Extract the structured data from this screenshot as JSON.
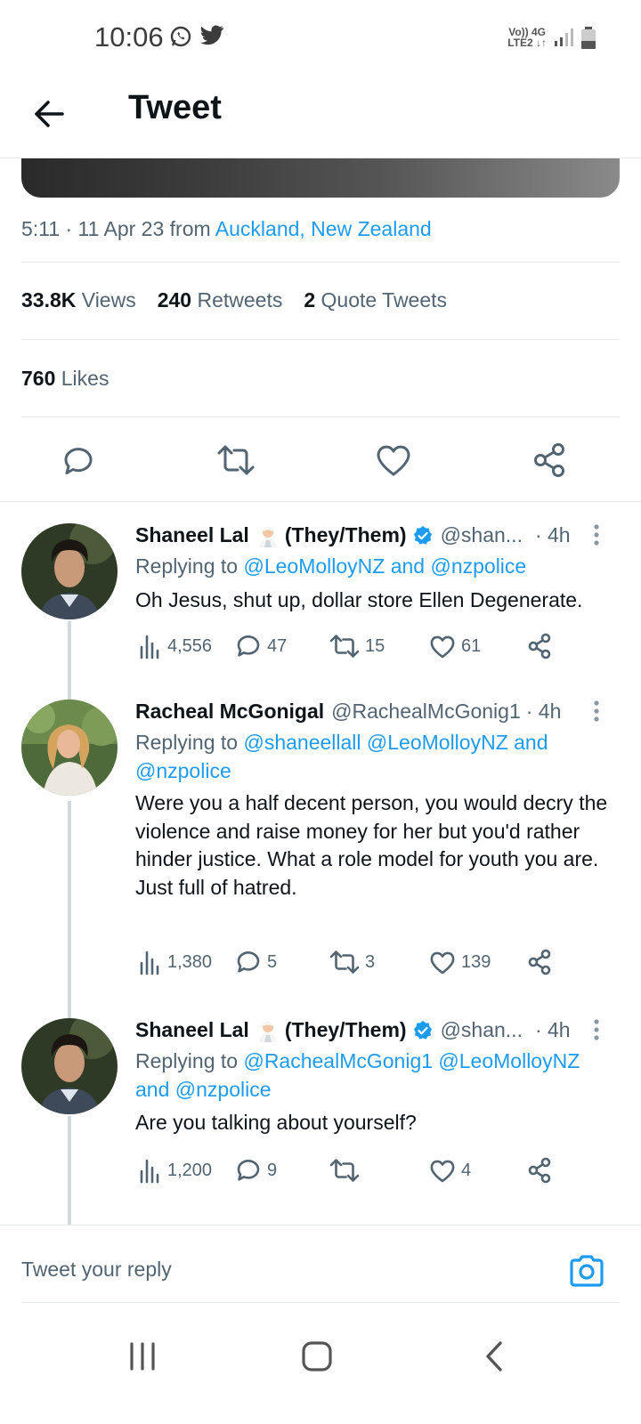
{
  "status_bar": {
    "time": "10:06",
    "network_top": "Vo)) 4G",
    "network_bottom": "LTE2 ↓↑",
    "app_icons": [
      "whatsapp-icon",
      "twitter-icon"
    ]
  },
  "header": {
    "title": "Tweet"
  },
  "tweet_meta": {
    "datetime": "5:11 · 11 Apr 23 from ",
    "location": "Auckland, New Zealand"
  },
  "stats": {
    "views_count": "33.8K",
    "views_label": "Views",
    "retweets_count": "240",
    "retweets_label": "Retweets",
    "quotes_count": "2",
    "quotes_label": "Quote Tweets",
    "likes_count": "760",
    "likes_label": "Likes"
  },
  "replies": [
    {
      "name": "Shaneel Lal",
      "name_suffix": "(They/Them)",
      "verified": true,
      "handle": "@shan...",
      "time": "· 4h",
      "replying_prefix": "Replying to ",
      "replying_line1": "@LeoMolloyNZ and @nzpolice",
      "replying_line2": "",
      "text": "Oh Jesus, shut up, dollar store Ellen Degenerate.",
      "views": "4,556",
      "comments": "47",
      "retweets": "15",
      "likes": "61"
    },
    {
      "name": "Racheal McGonigal",
      "name_suffix": "",
      "verified": false,
      "handle": "@RachealMcGonig1",
      "time": "· 4h",
      "replying_prefix": "Replying to ",
      "replying_line1": "@shaneellall @LeoMolloyNZ and",
      "replying_line2": "@nzpolice",
      "text": "Were you a half decent person, you would decry the violence and raise money for her but you'd rather hinder justice. What a role model for youth you are.\nJust full of hatred.",
      "views": "1,380",
      "comments": "5",
      "retweets": "3",
      "likes": "139"
    },
    {
      "name": "Shaneel Lal",
      "name_suffix": "(They/Them)",
      "verified": true,
      "handle": "@shan...",
      "time": "· 4h",
      "replying_prefix": "Replying to ",
      "replying_line1": "@RachealMcGonig1 @LeoMolloyNZ",
      "replying_line2": "and @nzpolice",
      "text": "Are you talking about yourself?",
      "views": "1,200",
      "comments": "9",
      "retweets": "",
      "likes": "4"
    }
  ],
  "reply_bar": {
    "placeholder": "Tweet your reply"
  },
  "colors": {
    "accent": "#1d9bf0",
    "muted": "#536471",
    "text": "#0f1419",
    "divider": "#e6e9ea"
  }
}
